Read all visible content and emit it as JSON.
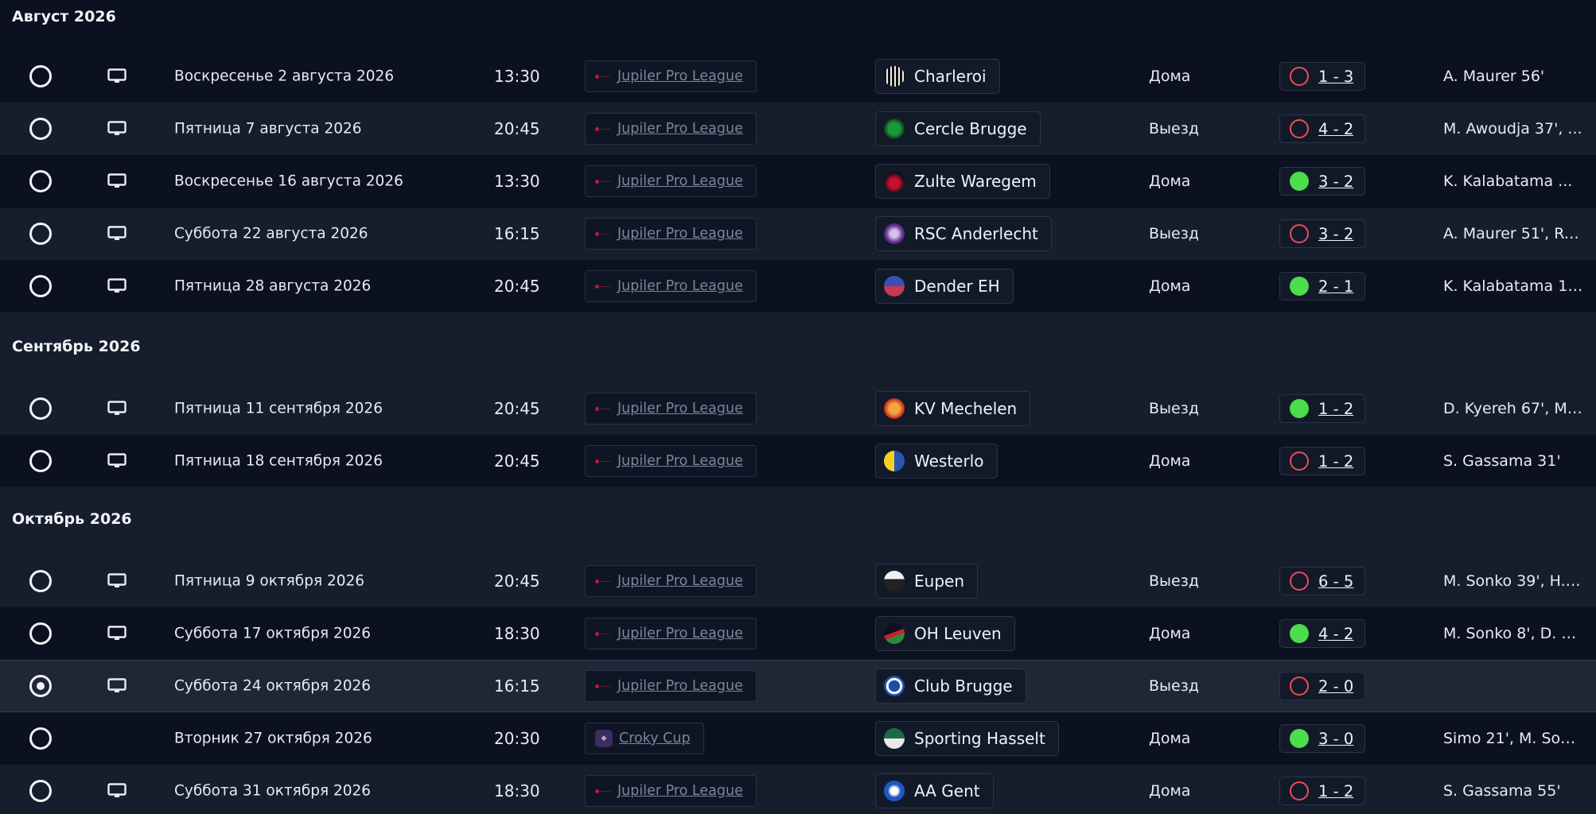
{
  "colors": {
    "background": "#0b1120",
    "row_alt": "#161d2c",
    "selected_row": "#1f2636",
    "win": "#4cdc4c",
    "loss": "#ef4b5a",
    "muted_text": "#7c8597"
  },
  "months": [
    {
      "title": "Август 2026",
      "matches": [
        {
          "date": "Воскресенье 2 августа 2026",
          "time": "13:30",
          "tv": true,
          "competition": "Jupiler Pro League",
          "competition_icon": "jupiler-logo",
          "opponent": "Charleroi",
          "team_icon": "charleroi-crest",
          "venue": "Дома",
          "result_type": "loss",
          "score": "1 - 3",
          "scorers": "A. Maurer 56'",
          "selected": false
        },
        {
          "date": "Пятница 7 августа 2026",
          "time": "20:45",
          "tv": true,
          "competition": "Jupiler Pro League",
          "competition_icon": "jupiler-logo",
          "opponent": "Cercle Brugge",
          "team_icon": "cercle-brugge-crest",
          "venue": "Выезд",
          "result_type": "loss",
          "score": "4 - 2",
          "scorers": "M. Awoudja 37', ...",
          "selected": false
        },
        {
          "date": "Воскресенье 16 августа 2026",
          "time": "13:30",
          "tv": true,
          "competition": "Jupiler Pro League",
          "competition_icon": "jupiler-logo",
          "opponent": "Zulte Waregem",
          "team_icon": "zulte-waregem-crest",
          "venue": "Дома",
          "result_type": "win",
          "score": "3 - 2",
          "scorers": "K. Kalabatama ...",
          "selected": false
        },
        {
          "date": "Суббота 22 августа 2026",
          "time": "16:15",
          "tv": true,
          "competition": "Jupiler Pro League",
          "competition_icon": "jupiler-logo",
          "opponent": "RSC Anderlecht",
          "team_icon": "anderlecht-crest",
          "venue": "Выезд",
          "result_type": "loss",
          "score": "3 - 2",
          "scorers": "A. Maurer 51', R. ...",
          "selected": false
        },
        {
          "date": "Пятница 28 августа 2026",
          "time": "20:45",
          "tv": true,
          "competition": "Jupiler Pro League",
          "competition_icon": "jupiler-logo",
          "opponent": "Dender EH",
          "team_icon": "dender-crest",
          "venue": "Дома",
          "result_type": "win",
          "score": "2 - 1",
          "scorers": "K. Kalabatama 1'...",
          "selected": false
        }
      ]
    },
    {
      "title": "Сентябрь 2026",
      "matches": [
        {
          "date": "Пятница 11 сентября 2026",
          "time": "20:45",
          "tv": true,
          "competition": "Jupiler Pro League",
          "competition_icon": "jupiler-logo",
          "opponent": "KV Mechelen",
          "team_icon": "mechelen-crest",
          "venue": "Выезд",
          "result_type": "win",
          "score": "1 - 2",
          "scorers": "D. Kyereh 67', M. ...",
          "selected": false
        },
        {
          "date": "Пятница 18 сентября 2026",
          "time": "20:45",
          "tv": true,
          "competition": "Jupiler Pro League",
          "competition_icon": "jupiler-logo",
          "opponent": "Westerlo",
          "team_icon": "westerlo-crest",
          "venue": "Дома",
          "result_type": "loss",
          "score": "1 - 2",
          "scorers": "S. Gassama 31'",
          "selected": false
        }
      ]
    },
    {
      "title": "Октябрь 2026",
      "matches": [
        {
          "date": "Пятница 9 октября 2026",
          "time": "20:45",
          "tv": true,
          "competition": "Jupiler Pro League",
          "competition_icon": "jupiler-logo",
          "opponent": "Eupen",
          "team_icon": "eupen-crest",
          "venue": "Выезд",
          "result_type": "loss",
          "score": "6 - 5",
          "scorers": "M. Sonko 39', H. ...",
          "selected": false
        },
        {
          "date": "Суббота 17 октября 2026",
          "time": "18:30",
          "tv": true,
          "competition": "Jupiler Pro League",
          "competition_icon": "jupiler-logo",
          "opponent": "OH Leuven",
          "team_icon": "oh-leuven-crest",
          "venue": "Дома",
          "result_type": "win",
          "score": "4 - 2",
          "scorers": "M. Sonko 8', D. K...",
          "selected": false
        },
        {
          "date": "Суббота 24 октября 2026",
          "time": "16:15",
          "tv": true,
          "competition": "Jupiler Pro League",
          "competition_icon": "jupiler-logo",
          "opponent": "Club Brugge",
          "team_icon": "club-brugge-crest",
          "venue": "Выезд",
          "result_type": "loss",
          "score": "2 - 0",
          "scorers": "",
          "selected": true
        },
        {
          "date": "Вторник 27 октября 2026",
          "time": "20:30",
          "tv": false,
          "competition": "Croky Cup",
          "competition_icon": "croky-cup-logo",
          "opponent": "Sporting Hasselt",
          "team_icon": "sporting-hasselt-crest",
          "venue": "Дома",
          "result_type": "win",
          "score": "3 - 0",
          "scorers": "Simo 21', M. Son...",
          "selected": false
        },
        {
          "date": "Суббота 31 октября 2026",
          "time": "18:30",
          "tv": true,
          "competition": "Jupiler Pro League",
          "competition_icon": "jupiler-logo",
          "opponent": "AA Gent",
          "team_icon": "aa-gent-crest",
          "venue": "Дома",
          "result_type": "loss",
          "score": "1 - 2",
          "scorers": "S. Gassama 55'",
          "selected": false
        }
      ]
    }
  ]
}
